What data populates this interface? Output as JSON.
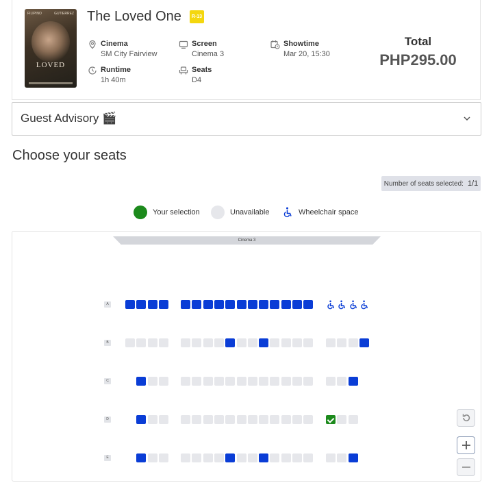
{
  "movie": {
    "title": "The Loved One",
    "rating": "R-13",
    "poster_title": "LOVED",
    "poster_names_left": "FILIPINO",
    "poster_names_right": "GUTIERREZ"
  },
  "details": {
    "cinema": {
      "label": "Cinema",
      "value": "SM City Fairview",
      "icon": "location-pin-icon"
    },
    "screen": {
      "label": "Screen",
      "value": "Cinema 3",
      "icon": "screen-icon"
    },
    "showtime": {
      "label": "Showtime",
      "value": "Mar 20, 15:30",
      "icon": "calendar-clock-icon"
    },
    "runtime": {
      "label": "Runtime",
      "value": "1h 40m",
      "icon": "clock-icon"
    },
    "seats": {
      "label": "Seats",
      "value": "D4",
      "icon": "seat-icon"
    }
  },
  "total": {
    "label": "Total",
    "value": "PHP295.00"
  },
  "advisory": {
    "label": "Guest Advisory 🎬",
    "icon": "chevron-down-icon"
  },
  "seat_selection": {
    "heading": "Choose your seats",
    "count_label": "Number of seats selected:",
    "count_value": "1/1"
  },
  "legend": {
    "selection": "Your selection",
    "unavailable": "Unavailable",
    "wheelchair": "Wheelchair space"
  },
  "colors": {
    "available": "#0a3dd6",
    "unavailable": "#e6e7eb",
    "selected": "#1c8a1c",
    "rating_badge": "#f4d70f"
  },
  "screen_label": "Cinema 3",
  "seat_map": {
    "rows": [
      {
        "label": "A",
        "blocks": [
          [
            "available",
            "available",
            "available",
            "available"
          ],
          [
            "available",
            "available",
            "available",
            "available",
            "available",
            "available",
            "available",
            "available",
            "available",
            "available",
            "available",
            "available"
          ],
          [
            "wheelchair",
            "wheelchair",
            "wheelchair",
            "wheelchair"
          ]
        ]
      },
      {
        "label": "B",
        "blocks": [
          [
            "unavailable",
            "unavailable",
            "unavailable",
            "unavailable"
          ],
          [
            "unavailable",
            "unavailable",
            "unavailable",
            "unavailable",
            "available",
            "unavailable",
            "unavailable",
            "available",
            "unavailable",
            "unavailable",
            "unavailable",
            "unavailable"
          ],
          [
            "unavailable",
            "unavailable",
            "unavailable",
            "available"
          ]
        ]
      },
      {
        "label": "C",
        "blocks": [
          [
            "empty",
            "available",
            "unavailable",
            "unavailable"
          ],
          [
            "unavailable",
            "unavailable",
            "unavailable",
            "unavailable",
            "unavailable",
            "unavailable",
            "unavailable",
            "unavailable",
            "unavailable",
            "unavailable",
            "unavailable",
            "unavailable"
          ],
          [
            "unavailable",
            "unavailable",
            "available",
            "empty"
          ]
        ]
      },
      {
        "label": "D",
        "blocks": [
          [
            "empty",
            "available",
            "unavailable",
            "unavailable"
          ],
          [
            "unavailable",
            "unavailable",
            "unavailable",
            "unavailable",
            "unavailable",
            "unavailable",
            "unavailable",
            "unavailable",
            "unavailable",
            "unavailable",
            "unavailable",
            "unavailable"
          ],
          [
            "selected",
            "unavailable",
            "unavailable",
            "empty"
          ]
        ]
      },
      {
        "label": "E",
        "blocks": [
          [
            "empty",
            "available",
            "unavailable",
            "unavailable"
          ],
          [
            "unavailable",
            "unavailable",
            "unavailable",
            "unavailable",
            "available",
            "unavailable",
            "unavailable",
            "available",
            "unavailable",
            "unavailable",
            "unavailable",
            "unavailable"
          ],
          [
            "unavailable",
            "unavailable",
            "available",
            "empty"
          ]
        ]
      }
    ]
  },
  "map_controls": {
    "reset": "reset-icon",
    "zoom_in": "plus-icon",
    "zoom_out": "minus-icon"
  }
}
